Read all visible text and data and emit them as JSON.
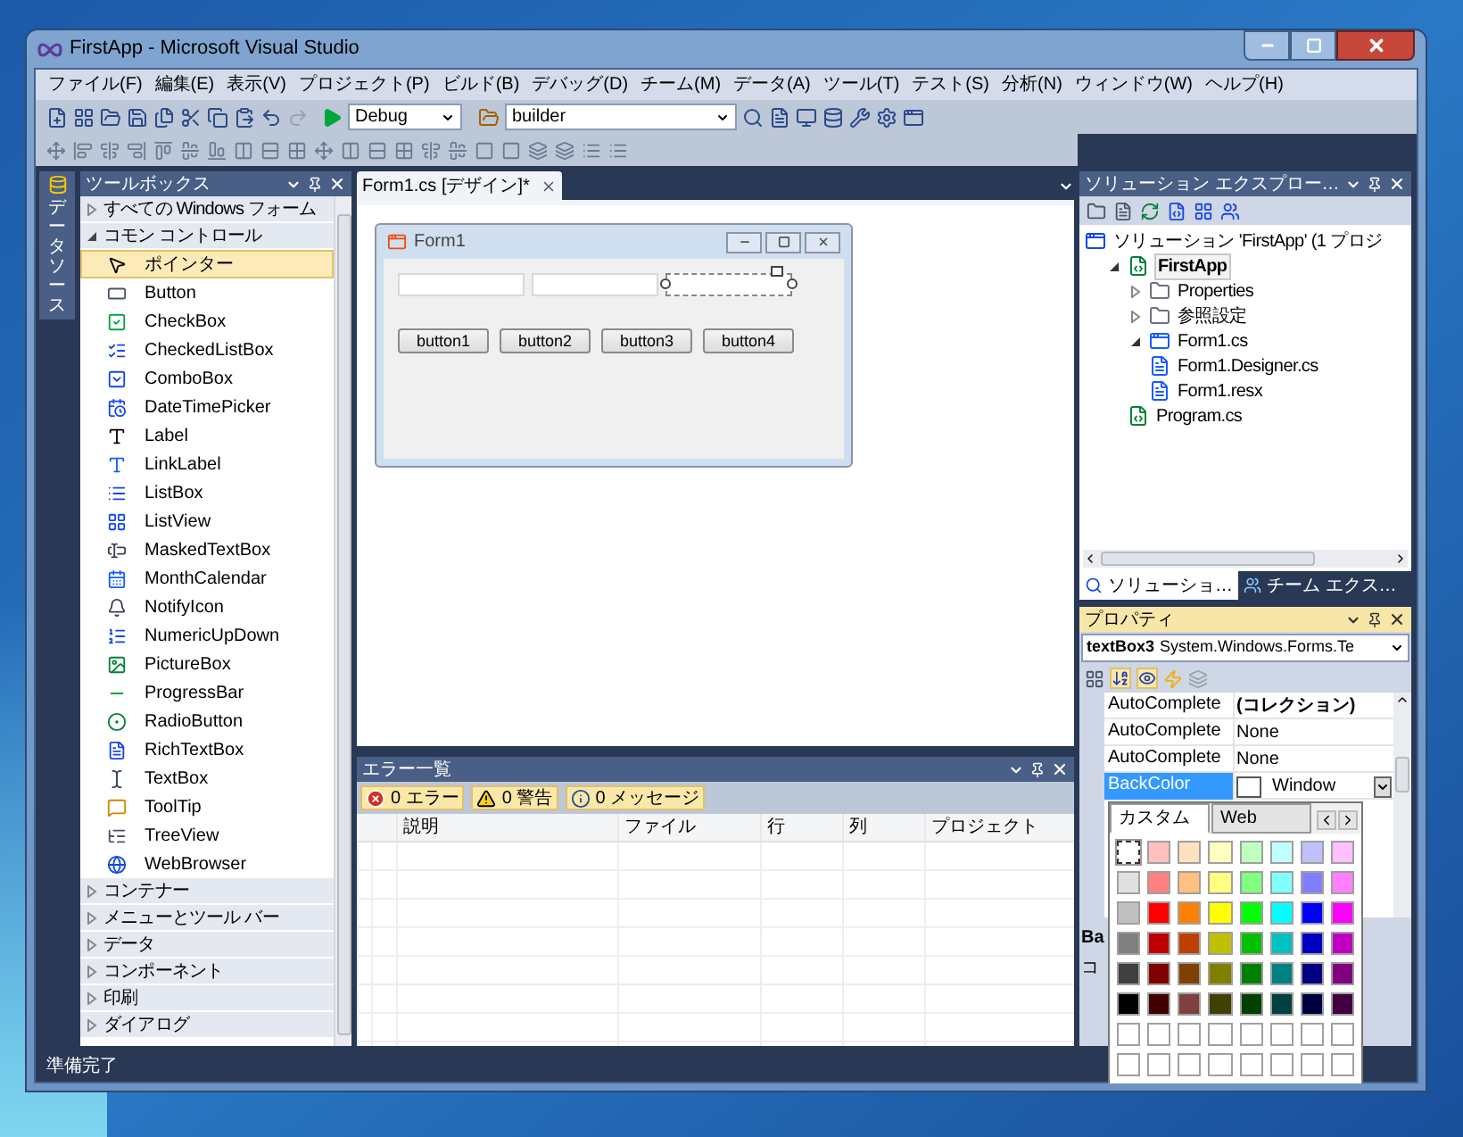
{
  "window": {
    "title": "FirstApp - Microsoft Visual Studio"
  },
  "menu": [
    "ファイル(F)",
    "編集(E)",
    "表示(V)",
    "プロジェクト(P)",
    "ビルド(B)",
    "デバッグ(D)",
    "チーム(M)",
    "データ(A)",
    "ツール(T)",
    "テスト(S)",
    "分析(N)",
    "ウィンドウ(W)",
    "ヘルプ(H)"
  ],
  "toolbar": {
    "configuration": "Debug",
    "target": "builder"
  },
  "side_tab": {
    "label": "データソース"
  },
  "toolbox": {
    "title": "ツールボックス",
    "groups": [
      {
        "label": "すべての Windows フォーム",
        "expanded": false
      },
      {
        "label": "コモン コントロール",
        "expanded": true,
        "items": [
          {
            "label": "ポインター",
            "selected": true
          },
          {
            "label": "Button",
            "selected": false
          },
          {
            "label": "CheckBox",
            "selected": false
          },
          {
            "label": "CheckedListBox",
            "selected": false
          },
          {
            "label": "ComboBox",
            "selected": false
          },
          {
            "label": "DateTimePicker",
            "selected": false
          },
          {
            "label": "Label",
            "selected": false
          },
          {
            "label": "LinkLabel",
            "selected": false
          },
          {
            "label": "ListBox",
            "selected": false
          },
          {
            "label": "ListView",
            "selected": false
          },
          {
            "label": "MaskedTextBox",
            "selected": false
          },
          {
            "label": "MonthCalendar",
            "selected": false
          },
          {
            "label": "NotifyIcon",
            "selected": false
          },
          {
            "label": "NumericUpDown",
            "selected": false
          },
          {
            "label": "PictureBox",
            "selected": false
          },
          {
            "label": "ProgressBar",
            "selected": false
          },
          {
            "label": "RadioButton",
            "selected": false
          },
          {
            "label": "RichTextBox",
            "selected": false
          },
          {
            "label": "TextBox",
            "selected": false
          },
          {
            "label": "ToolTip",
            "selected": false
          },
          {
            "label": "TreeView",
            "selected": false
          },
          {
            "label": "WebBrowser",
            "selected": false
          }
        ]
      },
      {
        "label": "コンテナー",
        "expanded": false
      },
      {
        "label": "メニューとツール バー",
        "expanded": false
      },
      {
        "label": "データ",
        "expanded": false
      },
      {
        "label": "コンポーネント",
        "expanded": false
      },
      {
        "label": "印刷",
        "expanded": false
      },
      {
        "label": "ダイアログ",
        "expanded": false
      }
    ]
  },
  "editor": {
    "tabs": [
      {
        "label": "Form1.cs [デザイン]*",
        "selected": true
      }
    ],
    "form": {
      "title": "Form1",
      "text_boxes": [
        {
          "selected": false
        },
        {
          "selected": false
        },
        {
          "selected": true
        }
      ],
      "buttons": [
        "button1",
        "button2",
        "button3",
        "button4"
      ]
    }
  },
  "error_list": {
    "title": "エラー一覧",
    "filters": [
      {
        "kind": "error",
        "label": "0 エラー"
      },
      {
        "kind": "warning",
        "label": "0 警告"
      },
      {
        "kind": "info",
        "label": "0 メッセージ"
      }
    ],
    "columns": [
      "説明",
      "ファイル",
      "行",
      "列",
      "プロジェクト"
    ]
  },
  "solution_explorer": {
    "title": "ソリューション エクスプロー…",
    "tree": [
      {
        "label": "ソリューション 'FirstApp' (1 プロジ",
        "kind": "solution",
        "selected": false,
        "children": [
          {
            "label": "FirstApp",
            "kind": "project",
            "selected": true,
            "expanded": true,
            "children": [
              {
                "label": "Properties",
                "kind": "folder",
                "selected": false,
                "expanded": false
              },
              {
                "label": "参照設定",
                "kind": "folder",
                "selected": false,
                "expanded": false
              },
              {
                "label": "Form1.cs",
                "kind": "form",
                "selected": false,
                "expanded": true,
                "children": [
                  {
                    "label": "Form1.Designer.cs",
                    "kind": "file",
                    "selected": false
                  },
                  {
                    "label": "Form1.resx",
                    "kind": "file",
                    "selected": false
                  }
                ]
              },
              {
                "label": "Program.cs",
                "kind": "code",
                "selected": false
              }
            ]
          }
        ]
      }
    ],
    "tabs": [
      {
        "label": "ソリューショ…",
        "selected": true
      },
      {
        "label": "チーム エクス…",
        "selected": false
      }
    ]
  },
  "properties": {
    "title": "プロパティ",
    "object": "textBox3",
    "type": "System.Windows.Forms.Te",
    "rows": [
      {
        "name": "AutoComplete",
        "value": "(コレクション)",
        "selected": false
      },
      {
        "name": "AutoComplete",
        "value": "None",
        "selected": false
      },
      {
        "name": "AutoComplete",
        "value": "None",
        "selected": false
      },
      {
        "name": "BackColor",
        "value": "Window",
        "selected": true
      }
    ],
    "description": [
      "Ba",
      "コ"
    ]
  },
  "color_picker": {
    "tabs": [
      {
        "label": "カスタム",
        "selected": true
      },
      {
        "label": "Web",
        "selected": false
      }
    ],
    "swatches": [
      {
        "color": "#ffffff",
        "selected": true
      },
      {
        "color": "#ffc0c0",
        "selected": false
      },
      {
        "color": "#ffe0c0",
        "selected": false
      },
      {
        "color": "#ffffc0",
        "selected": false
      },
      {
        "color": "#c0ffc0",
        "selected": false
      },
      {
        "color": "#c0ffff",
        "selected": false
      },
      {
        "color": "#c0c0ff",
        "selected": false
      },
      {
        "color": "#ffc0ff",
        "selected": false
      },
      {
        "color": "#e0e0e0",
        "selected": false
      },
      {
        "color": "#ff8080",
        "selected": false
      },
      {
        "color": "#ffc080",
        "selected": false
      },
      {
        "color": "#ffff80",
        "selected": false
      },
      {
        "color": "#80ff80",
        "selected": false
      },
      {
        "color": "#80ffff",
        "selected": false
      },
      {
        "color": "#8080ff",
        "selected": false
      },
      {
        "color": "#ff80ff",
        "selected": false
      },
      {
        "color": "#c0c0c0",
        "selected": false
      },
      {
        "color": "#ff0000",
        "selected": false
      },
      {
        "color": "#ff8000",
        "selected": false
      },
      {
        "color": "#ffff00",
        "selected": false
      },
      {
        "color": "#00ff00",
        "selected": false
      },
      {
        "color": "#00ffff",
        "selected": false
      },
      {
        "color": "#0000ff",
        "selected": false
      },
      {
        "color": "#ff00ff",
        "selected": false
      },
      {
        "color": "#808080",
        "selected": false
      },
      {
        "color": "#c00000",
        "selected": false
      },
      {
        "color": "#c04000",
        "selected": false
      },
      {
        "color": "#c0c000",
        "selected": false
      },
      {
        "color": "#00c000",
        "selected": false
      },
      {
        "color": "#00c0c0",
        "selected": false
      },
      {
        "color": "#0000c0",
        "selected": false
      },
      {
        "color": "#c000c0",
        "selected": false
      },
      {
        "color": "#404040",
        "selected": false
      },
      {
        "color": "#800000",
        "selected": false
      },
      {
        "color": "#804000",
        "selected": false
      },
      {
        "color": "#808000",
        "selected": false
      },
      {
        "color": "#008000",
        "selected": false
      },
      {
        "color": "#008080",
        "selected": false
      },
      {
        "color": "#000080",
        "selected": false
      },
      {
        "color": "#800080",
        "selected": false
      },
      {
        "color": "#000000",
        "selected": false
      },
      {
        "color": "#400000",
        "selected": false
      },
      {
        "color": "#804040",
        "selected": false
      },
      {
        "color": "#404000",
        "selected": false
      },
      {
        "color": "#004000",
        "selected": false
      },
      {
        "color": "#004040",
        "selected": false
      },
      {
        "color": "#000040",
        "selected": false
      },
      {
        "color": "#400040",
        "selected": false
      },
      {
        "color": "#ffffff",
        "selected": false
      },
      {
        "color": "#ffffff",
        "selected": false
      },
      {
        "color": "#ffffff",
        "selected": false
      },
      {
        "color": "#ffffff",
        "selected": false
      },
      {
        "color": "#ffffff",
        "selected": false
      },
      {
        "color": "#ffffff",
        "selected": false
      },
      {
        "color": "#ffffff",
        "selected": false
      },
      {
        "color": "#ffffff",
        "selected": false
      },
      {
        "color": "#ffffff",
        "selected": false
      },
      {
        "color": "#ffffff",
        "selected": false
      },
      {
        "color": "#ffffff",
        "selected": false
      },
      {
        "color": "#ffffff",
        "selected": false
      },
      {
        "color": "#ffffff",
        "selected": false
      },
      {
        "color": "#ffffff",
        "selected": false
      },
      {
        "color": "#ffffff",
        "selected": false
      },
      {
        "color": "#ffffff",
        "selected": false
      }
    ]
  },
  "status_bar": "準備完了"
}
